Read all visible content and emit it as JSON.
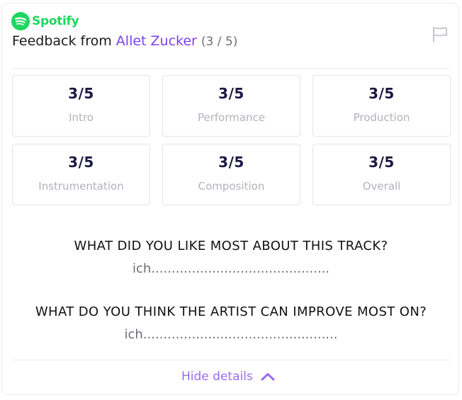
{
  "brand": {
    "name": "Spotify",
    "color": "#1ed760",
    "icon": "spotify-logo-icon"
  },
  "header": {
    "title_prefix": "Feedback from",
    "artist": "Allet Zucker",
    "count": "(3 / 5)",
    "flag_icon": "flag-icon"
  },
  "ratings": [
    {
      "score": "3/5",
      "label": "Intro"
    },
    {
      "score": "3/5",
      "label": "Performance"
    },
    {
      "score": "3/5",
      "label": "Production"
    },
    {
      "score": "3/5",
      "label": "Instrumentation"
    },
    {
      "score": "3/5",
      "label": "Composition"
    },
    {
      "score": "3/5",
      "label": "Overall"
    }
  ],
  "questions": [
    {
      "question": "WHAT DID YOU LIKE MOST ABOUT THIS TRACK?",
      "answer": "ich............................................"
    },
    {
      "question": "WHAT DO YOU THINK THE ARTIST CAN IMPROVE MOST ON?",
      "answer": "ich................................................"
    }
  ],
  "footer": {
    "toggle_label": "Hide details",
    "toggle_icon": "chevron-up-icon"
  },
  "colors": {
    "accent": "#7b3ff2",
    "toggle": "#9b6cf0",
    "score": "#1c1842"
  }
}
